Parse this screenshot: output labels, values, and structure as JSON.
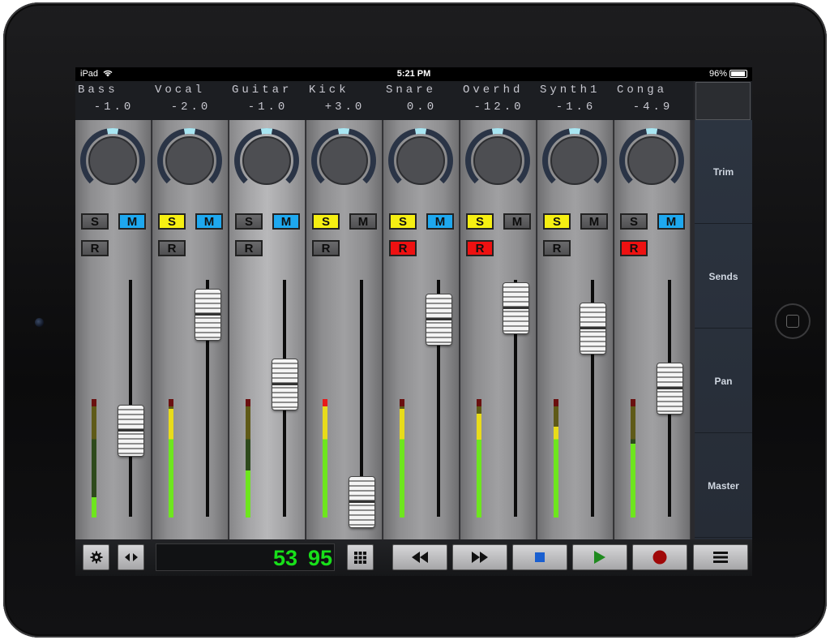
{
  "status": {
    "device": "iPad",
    "time": "5:21 PM",
    "battery": "96%"
  },
  "channels": [
    {
      "name": "Bass",
      "value": "-1.0",
      "solo": false,
      "mute": true,
      "rec": false,
      "fader": 0.38,
      "meter": 0.17,
      "meter_color": "#66e020",
      "selected": false,
      "knob": 0.5
    },
    {
      "name": "Vocal",
      "value": "-2.0",
      "solo": true,
      "mute": true,
      "rec": false,
      "fader": 0.88,
      "meter": 0.92,
      "meter_color": "#66e020",
      "selected": false,
      "knob": 0.5
    },
    {
      "name": "Guitar",
      "value": "-1.0",
      "solo": false,
      "mute": true,
      "rec": false,
      "fader": 0.58,
      "meter": 0.4,
      "meter_color": "#66e020",
      "selected": true,
      "knob": 0.5
    },
    {
      "name": "Kick",
      "value": "+3.0",
      "solo": true,
      "mute": false,
      "rec": false,
      "fader": 0.07,
      "meter": 1.0,
      "meter_color": "#66e020",
      "selected": false,
      "knob": 0.5
    },
    {
      "name": "Snare",
      "value": "0.0",
      "solo": true,
      "mute": true,
      "rec": true,
      "fader": 0.86,
      "meter": 0.92,
      "meter_color": "#66e020",
      "selected": false,
      "knob": 0.5
    },
    {
      "name": "Overhd",
      "value": "-12.0",
      "solo": true,
      "mute": false,
      "rec": true,
      "fader": 0.91,
      "meter": 0.88,
      "meter_color": "#66e020",
      "selected": false,
      "knob": 0.5
    },
    {
      "name": "Synth1",
      "value": "-1.6",
      "solo": true,
      "mute": false,
      "rec": false,
      "fader": 0.82,
      "meter": 0.77,
      "meter_color": "#66e020",
      "selected": false,
      "knob": 0.5
    },
    {
      "name": "Conga",
      "value": "-4.9",
      "solo": false,
      "mute": true,
      "rec": true,
      "fader": 0.56,
      "meter": 0.62,
      "meter_color": "#66e020",
      "selected": false,
      "knob": 0.5
    }
  ],
  "buttons": {
    "solo": "S",
    "mute": "M",
    "rec": "R"
  },
  "sidebar": [
    "Trim",
    "Sends",
    "Pan",
    "Master"
  ],
  "counter": {
    "bars": "53",
    "beats": "95"
  },
  "colors": {
    "solo_on": "#f6ef12",
    "mute_on": "#1ea8ef",
    "rec_on": "#ee1111",
    "counter": "#18e01a"
  },
  "toolbar_icons": [
    "gear-icon",
    "arrows-left-right-icon",
    "grid-icon",
    "rewind-icon",
    "fast-forward-icon",
    "stop-icon",
    "play-icon",
    "record-icon",
    "menu-icon"
  ]
}
